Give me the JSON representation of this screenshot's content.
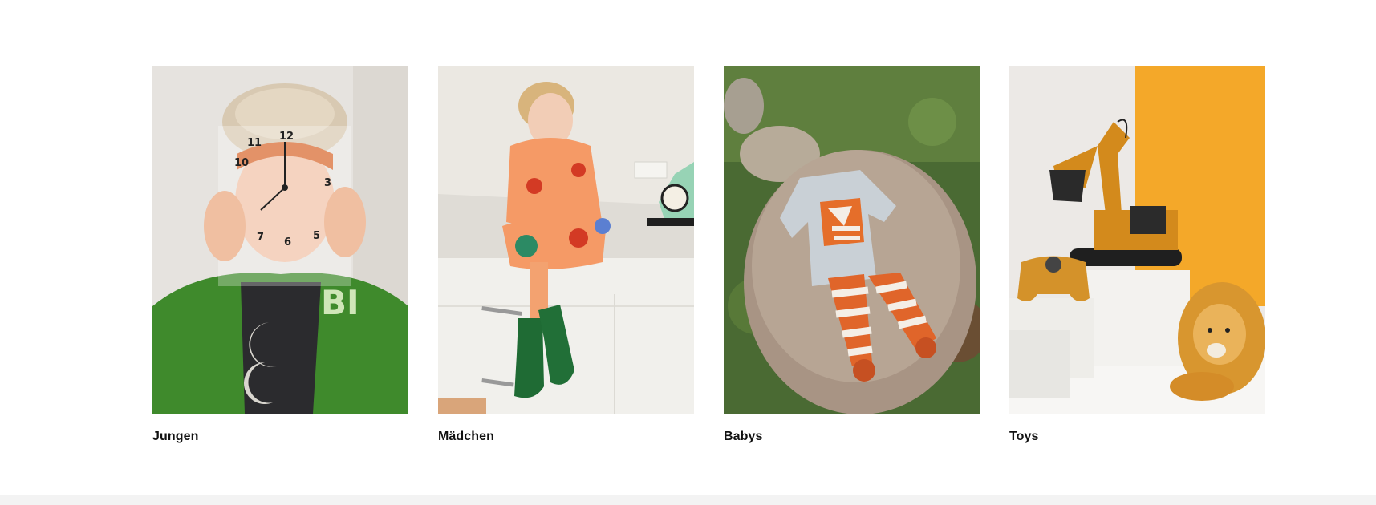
{
  "categories": [
    {
      "label": "Jungen",
      "image": "boy-holding-clock-photo"
    },
    {
      "label": "Mädchen",
      "image": "girl-on-counter-photo"
    },
    {
      "label": "Babys",
      "image": "baby-fox-outfit-photo"
    },
    {
      "label": "Toys",
      "image": "toy-excavator-lion-photo"
    }
  ]
}
